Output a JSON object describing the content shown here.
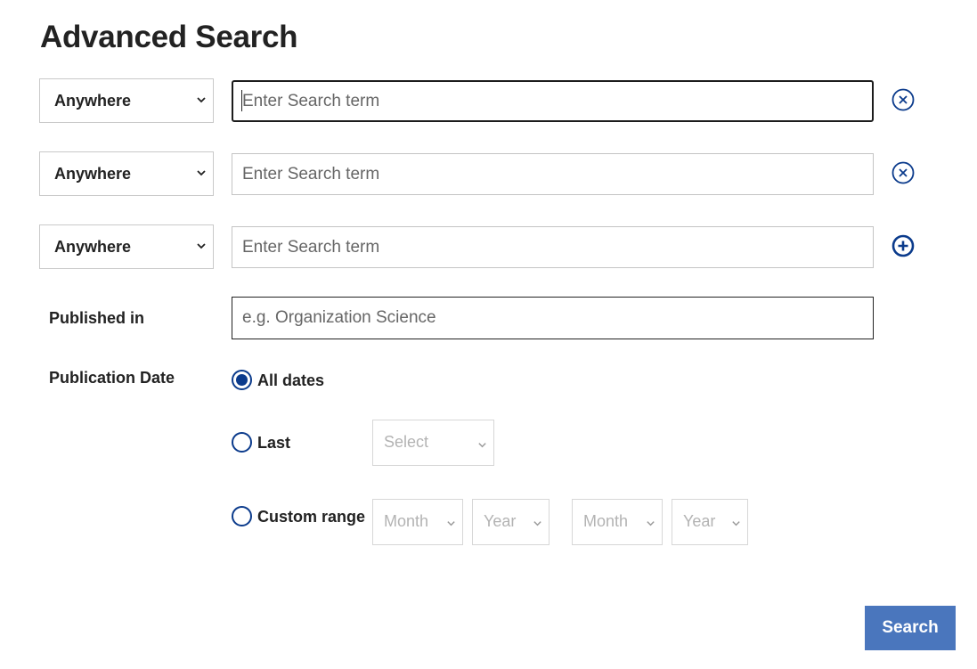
{
  "page": {
    "title": "Advanced Search"
  },
  "search_rows": [
    {
      "field": "Anywhere",
      "placeholder": "Enter Search term",
      "value": "",
      "action_icon": "remove-circle-icon"
    },
    {
      "field": "Anywhere",
      "placeholder": "Enter Search term",
      "value": "",
      "action_icon": "remove-circle-icon"
    },
    {
      "field": "Anywhere",
      "placeholder": "Enter Search term",
      "value": "",
      "action_icon": "add-circle-icon"
    }
  ],
  "published_in": {
    "label": "Published in",
    "placeholder": "e.g. Organization Science",
    "value": ""
  },
  "publication_date": {
    "label": "Publication Date",
    "selected": "All dates",
    "options": {
      "all_dates": "All dates",
      "last": "Last",
      "custom_range": "Custom range"
    },
    "last_select": {
      "value": "Select"
    },
    "custom_range": {
      "from_month": "Month",
      "from_year": "Year",
      "to_month": "Month",
      "to_year": "Year"
    }
  },
  "actions": {
    "search_label": "Search"
  },
  "colors": {
    "accent": "#0b3b8c",
    "button": "#4a76bd",
    "text": "#222222",
    "placeholder": "#b3b3b3"
  }
}
